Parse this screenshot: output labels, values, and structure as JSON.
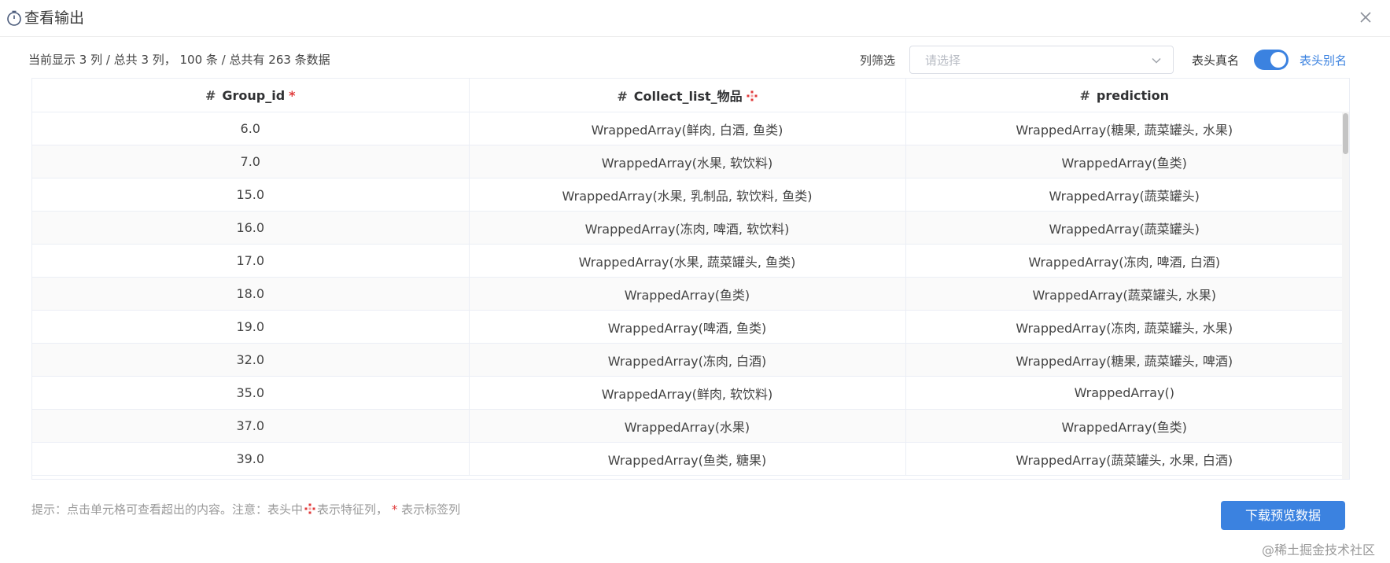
{
  "window": {
    "title": "查看输出"
  },
  "toolbar": {
    "summary": "当前显示 3 列 / 总共 3 列， 100 条 / 总共有 263 条数据",
    "filter_label": "列筛选",
    "filter_placeholder": "请选择",
    "toggle_label": "表头真名",
    "toggle_on": true,
    "alias_link": "表头别名"
  },
  "table": {
    "columns": [
      {
        "hash": "#",
        "name": "Group_id",
        "star": "*"
      },
      {
        "hash": "#",
        "name": "Collect_list_物品"
      },
      {
        "hash": "#",
        "name": "prediction"
      }
    ],
    "rows": [
      [
        "6.0",
        "WrappedArray(鲜肉, 白酒, 鱼类)",
        "WrappedArray(糖果, 蔬菜罐头, 水果)"
      ],
      [
        "7.0",
        "WrappedArray(水果, 软饮料)",
        "WrappedArray(鱼类)"
      ],
      [
        "15.0",
        "WrappedArray(水果, 乳制品, 软饮料, 鱼类)",
        "WrappedArray(蔬菜罐头)"
      ],
      [
        "16.0",
        "WrappedArray(冻肉, 啤酒, 软饮料)",
        "WrappedArray(蔬菜罐头)"
      ],
      [
        "17.0",
        "WrappedArray(水果, 蔬菜罐头, 鱼类)",
        "WrappedArray(冻肉, 啤酒, 白酒)"
      ],
      [
        "18.0",
        "WrappedArray(鱼类)",
        "WrappedArray(蔬菜罐头, 水果)"
      ],
      [
        "19.0",
        "WrappedArray(啤酒, 鱼类)",
        "WrappedArray(冻肉, 蔬菜罐头, 水果)"
      ],
      [
        "32.0",
        "WrappedArray(冻肉, 白酒)",
        "WrappedArray(糖果, 蔬菜罐头, 啤酒)"
      ],
      [
        "35.0",
        "WrappedArray(鲜肉, 软饮料)",
        "WrappedArray()"
      ],
      [
        "37.0",
        "WrappedArray(水果)",
        "WrappedArray(鱼类)"
      ],
      [
        "39.0",
        "WrappedArray(鱼类, 糖果)",
        "WrappedArray(蔬菜罐头, 水果, 白酒)"
      ]
    ]
  },
  "footer": {
    "tip_prefix": "提示：点击单元格可查看超出的内容。注意：表头中",
    "tip_mid": "表示特征列，",
    "tip_star": "*",
    "tip_suffix": "表示标签列",
    "download_label": "下载预览数据",
    "watermark": "@稀土掘金技术社区"
  },
  "colors": {
    "accent": "#3b82e0",
    "required": "#e03a3a",
    "feature": "#e03a3a"
  },
  "icons": [
    "timer-icon",
    "close-icon",
    "chevron-down-icon",
    "feature-column-icon"
  ]
}
